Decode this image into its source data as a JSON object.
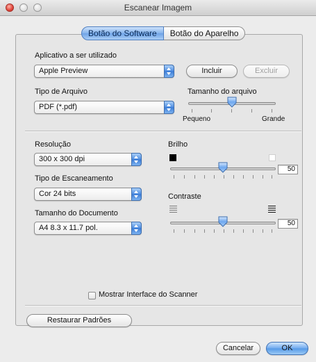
{
  "window": {
    "title": "Escanear Imagem"
  },
  "tabs": [
    {
      "label": "Botão do Software",
      "selected": true
    },
    {
      "label": "Botão do Aparelho",
      "selected": false
    }
  ],
  "application": {
    "label": "Aplicativo a ser utilizado",
    "selected": "Apple Preview",
    "include_button": "Incluir",
    "exclude_button": "Excluir"
  },
  "file_type": {
    "label": "Tipo de Arquivo",
    "selected": "PDF (*.pdf)"
  },
  "file_size": {
    "label": "Tamanho do arquivo",
    "min_label": "Pequeno",
    "max_label": "Grande",
    "level_fraction": 0.5
  },
  "resolution": {
    "label": "Resolução",
    "selected": "300 x 300 dpi"
  },
  "scan_type": {
    "label": "Tipo de Escaneamento",
    "selected": "Cor 24 bits"
  },
  "document_size": {
    "label": "Tamanho do Documento",
    "selected": "A4 8.3 x 11.7 pol."
  },
  "brightness": {
    "label": "Brilho",
    "value": "50",
    "min": 0,
    "max": 100
  },
  "contrast": {
    "label": "Contraste",
    "value": "50",
    "min": 0,
    "max": 100
  },
  "show_scanner_interface": {
    "label": "Mostrar Interface do Scanner",
    "checked": false
  },
  "restore_defaults_button": "Restaurar Padrões",
  "cancel_button": "Cancelar",
  "ok_button": "OK",
  "colors": {
    "accent": "#5a9be6",
    "close_button": "#e0443a"
  }
}
